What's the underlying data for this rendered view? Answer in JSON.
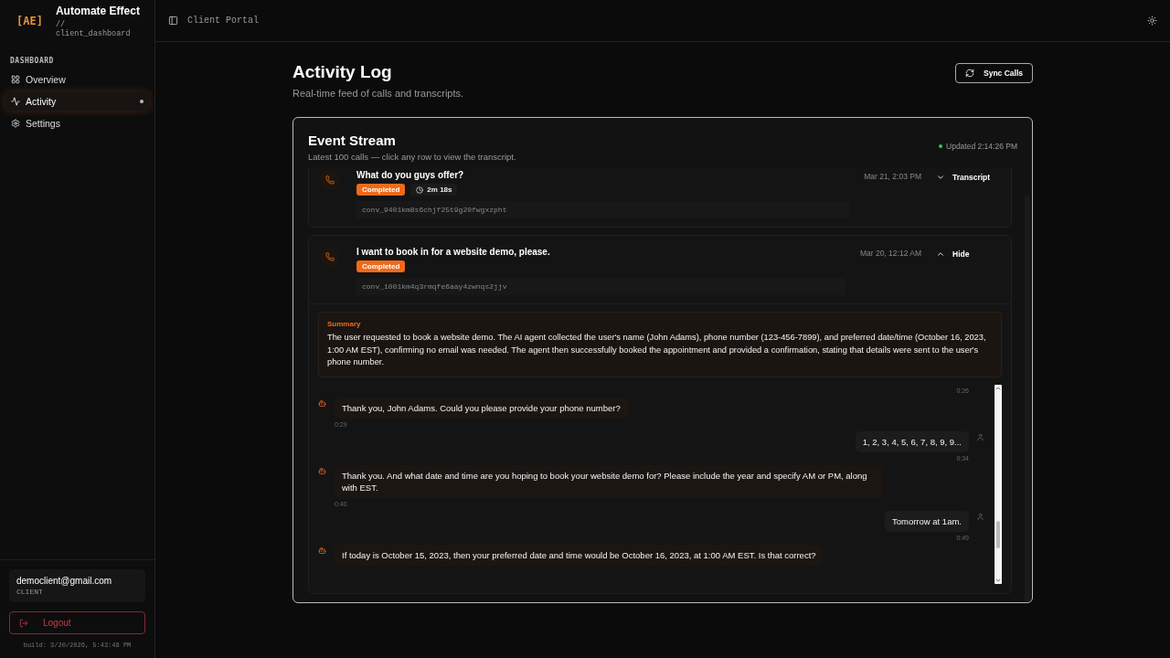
{
  "brand": {
    "mark": "[AE]",
    "name": "Automate Effect",
    "sub": "// client_dashboard"
  },
  "sidebar": {
    "section": "DASHBOARD",
    "items": [
      {
        "label": "Overview",
        "selected": false
      },
      {
        "label": "Activity",
        "selected": true
      },
      {
        "label": "Settings",
        "selected": false
      }
    ],
    "user": {
      "email": "democlient@gmail.com",
      "role": "CLIENT"
    },
    "logout": "Logout",
    "build": "build: 3/20/2026, 5:43:48 PM"
  },
  "topbar": {
    "title": "Client Portal"
  },
  "page": {
    "title": "Activity Log",
    "subtitle": "Real-time feed of calls and transcripts.",
    "sync_button": "Sync Calls"
  },
  "stream": {
    "title": "Event Stream",
    "subtitle": "Latest 100 calls — click any row to view the transcript.",
    "updated": "Updated 2:14:26 PM",
    "calls": [
      {
        "title": "What do you guys offer?",
        "status": "Completed",
        "duration": "2m 18s",
        "date": "Mar 21, 2:03 PM",
        "id": "conv_9401km8s6chjf25t9g20fwgxzpht",
        "expanded": false,
        "toggle": "Transcript"
      },
      {
        "title": "I want to book in for a website demo, please.",
        "status": "Completed",
        "date": "Mar 20, 12:12 AM",
        "id": "conv_1001km4q3rmqfe6aay4zwnqs2jjv",
        "expanded": true,
        "toggle": "Hide",
        "summary_label": "Summary",
        "summary": "The user requested to book a website demo. The AI agent collected the user's name (John Adams), phone number (123-456-7899), and preferred date/time (October 16, 2023, 1:00 AM EST), confirming no email was needed. The agent then successfully booked the appointment and provided a confirmation, stating that details were sent to the user's phone number.",
        "transcript": [
          {
            "kind": "user",
            "time": "0:26"
          },
          {
            "kind": "agent",
            "text": "Thank you, John Adams. Could you please provide your phone number?",
            "time": "0:29"
          },
          {
            "kind": "user",
            "text": "1, 2, 3, 4, 5, 6, 7, 8, 9, 9...",
            "time": "0:34"
          },
          {
            "kind": "agent",
            "text": "Thank you. And what date and time are you hoping to book your website demo for? Please include the year and specify AM or PM, along with EST.",
            "time": "0:40"
          },
          {
            "kind": "user",
            "text": "Tomorrow at 1am.",
            "time": "0:49"
          },
          {
            "kind": "agent",
            "text": "If today is October 15, 2023, then your preferred date and time would be October 16, 2023, at 1:00 AM EST. Is that correct?"
          }
        ]
      }
    ]
  }
}
